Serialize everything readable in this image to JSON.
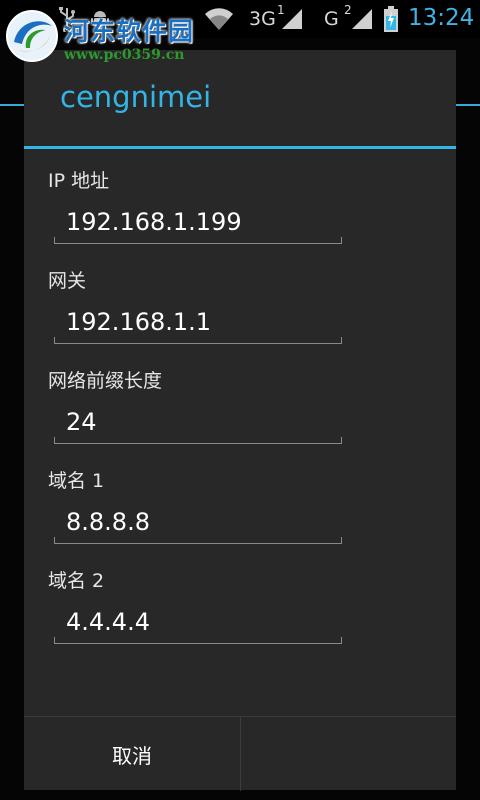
{
  "status_bar": {
    "network1": "3G",
    "network1_sup": "1",
    "network2": "G",
    "network2_sup": "2",
    "time": "13:24",
    "icons": [
      "usb-icon",
      "android-debug-icon",
      "wifi-icon",
      "signal-icon",
      "signal-icon",
      "battery-charging-icon"
    ]
  },
  "watermark": {
    "title": "河东软件园",
    "url": "www.pc0359.cn",
    "logo_icon": "logo-icon"
  },
  "dialog": {
    "title": "cengnimei",
    "fields": [
      {
        "label": "IP 地址",
        "value": "192.168.1.199"
      },
      {
        "label": "网关",
        "value": "192.168.1.1"
      },
      {
        "label": "网络前缀长度",
        "value": "24"
      },
      {
        "label": "域名 1",
        "value": "8.8.8.8"
      },
      {
        "label": "域名 2",
        "value": "4.4.4.4"
      }
    ],
    "cancel_label": "取消",
    "ok_label": ""
  },
  "colors": {
    "accent": "#33b5e5",
    "dialog_bg": "#282828",
    "watermark_blue": "#1a6fc0",
    "watermark_green": "#2d9a2d"
  }
}
